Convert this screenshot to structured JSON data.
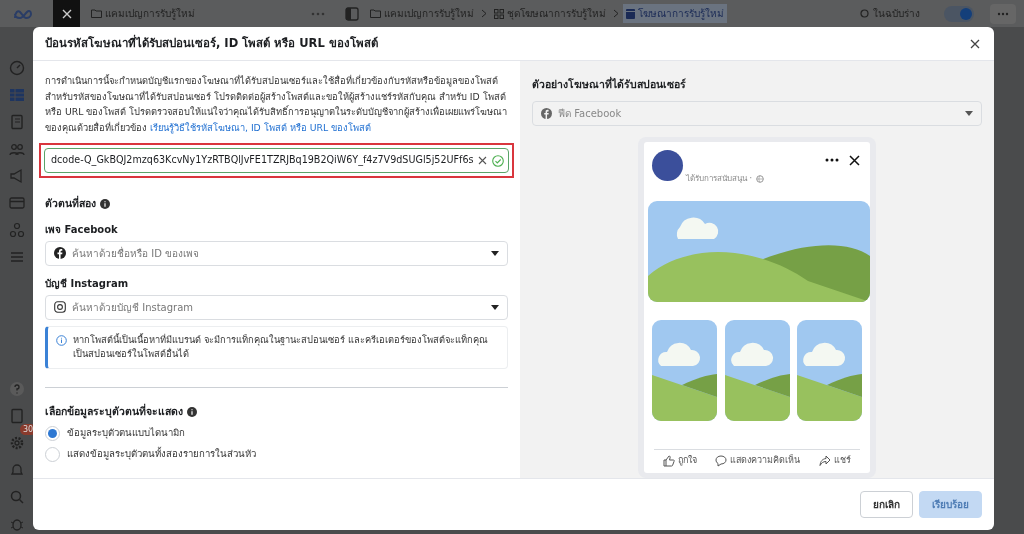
{
  "app": {
    "campaign_label": "แคมเปญการรับรู้ใหม่",
    "breadcrumbs": [
      {
        "label": "แคมเปญการรับรู้ใหม่",
        "kind": "campaign",
        "selected": false
      },
      {
        "label": "ชุดโฆษณาการรับรู้ใหม่",
        "kind": "adset",
        "selected": false
      },
      {
        "label": "โฆษณาการรับรู้ใหม่",
        "kind": "ad",
        "selected": true
      }
    ],
    "status": "ในฉบับร่าง",
    "draft_toggle": {
      "on": true
    },
    "notification_count": "30"
  },
  "dialog": {
    "title": "ป้อนรหัสโฆษณาที่ได้รับสปอนเซอร์, ID โพสต์ หรือ URL ของโพสต์",
    "intro": "การดำเนินการนี้จะกำหนดบัญชีแรกของโฆษณาที่ได้รับสปอนเซอร์และใช้สื่อที่เกี่ยวข้องกับรหัสหรือข้อมูลของโพสต์ สำหรับรหัสของโฆษณาที่ได้รับสปอนเซอร์ โปรดติดต่อผู้สร้างโพสต์และขอให้ผู้สร้างแชร์รหัสกับคุณ สำหรับ ID โพสต์ หรือ URL ของโพสต์ โปรดตรวจสอบให้แน่ใจว่าคุณได้รับสิทธิ์การอนุญาตในระดับบัญชีจากผู้สร้างเพื่อเผยแพร่โฆษณาของคุณด้วยสื่อที่เกี่ยวข้อง",
    "intro_link": "เรียนรู้วิธีใช้รหัสโฆษณา, ID โพสต์ หรือ URL ของโพสต์",
    "code_field": {
      "value": "dcode-Q_GkBQJ2mzq63KcvNy1YzRTBQlJvFE1TZRJBq19B2QiW6Y_f4z7V9dSUGl5j52UFf6s",
      "valid": true,
      "highlighted": true
    },
    "second_identity": {
      "title": "ตัวตนที่สอง",
      "fields": [
        {
          "label": "เพจ Facebook",
          "placeholder": "ค้นหาด้วยชื่อหรือ ID ของเพจ",
          "kind": "facebook"
        },
        {
          "label": "บัญชี Instagram",
          "placeholder": "ค้นหาด้วยบัญชี Instagram",
          "kind": "instagram"
        }
      ],
      "notice": "หากโพสต์นี้เป็นเนื้อหาที่มีแบรนด์ จะมีการแท็กคุณในฐานะสปอนเซอร์ และครีเอเตอร์ของโพสต์จะแท็กคุณเป็นสปอนเซอร์ในโพสต์อื่นได้"
    },
    "identity_display": {
      "title": "เลือกข้อมูลระบุตัวตนที่จะแสดง",
      "options": [
        {
          "label": "ข้อมูลระบุตัวตนแบบไดนามิก",
          "selected": true
        },
        {
          "label": "แสดงข้อมูลระบุตัวตนทั้งสองรายการในส่วนหัว",
          "selected": false
        }
      ]
    },
    "preview": {
      "title": "ตัวอย่างโฆษณาที่ได้รับสปอนเซอร์",
      "placement": "ฟีด Facebook",
      "sponsored": "ได้รับการสนับสนุน ·",
      "actions": [
        {
          "label": "ถูกใจ",
          "kind": "like"
        },
        {
          "label": "แสดงความคิดเห็น",
          "kind": "comment"
        },
        {
          "label": "แชร์",
          "kind": "share"
        }
      ]
    },
    "buttons": [
      {
        "label": "ยกเลิก",
        "kind": "secondary",
        "disabled": false
      },
      {
        "label": "เรียบร้อย",
        "kind": "primary",
        "disabled": true
      }
    ]
  }
}
